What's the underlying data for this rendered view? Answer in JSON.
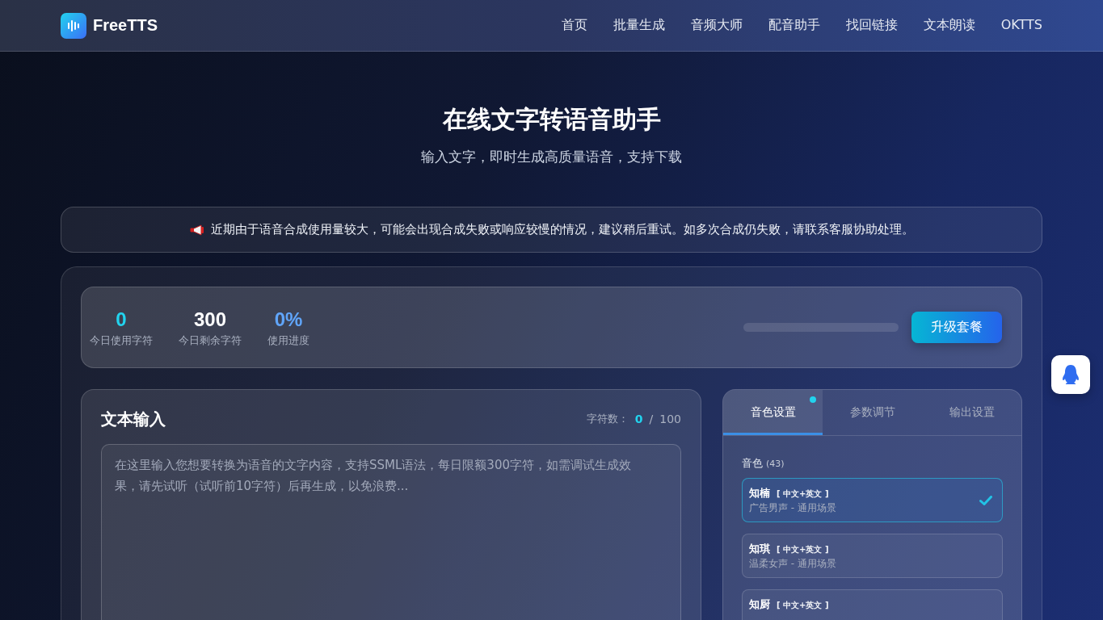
{
  "header": {
    "logo_text": "FreeTTS",
    "nav": [
      {
        "label": "首页"
      },
      {
        "label": "批量生成"
      },
      {
        "label": "音频大师"
      },
      {
        "label": "配音助手"
      },
      {
        "label": "找回链接"
      },
      {
        "label": "文本朗读"
      },
      {
        "label": "OKTTS"
      }
    ]
  },
  "hero": {
    "title": "在线文字转语音助手",
    "subtitle": "输入文字，即时生成高质量语音，支持下载"
  },
  "notice": {
    "text": "近期由于语音合成使用量较大，可能会出现合成失败或响应较慢的情况，建议稍后重试。如多次合成仍失败，请联系客服协助处理。"
  },
  "usage": {
    "stats": [
      {
        "value": "0",
        "label": "今日使用字符",
        "color": "#22d3ee"
      },
      {
        "value": "300",
        "label": "今日剩余字符",
        "color": "#ffffff"
      },
      {
        "value": "0%",
        "label": "使用进度",
        "color": "#60a5fa"
      }
    ],
    "progress": {
      "level": 0
    },
    "upgrade_button": "升级套餐"
  },
  "text_input": {
    "title": "文本输入",
    "count_label": "字符数：",
    "count": "0",
    "separator": "/",
    "limit": "100",
    "placeholder": "在这里输入您想要转换为语音的文字内容，支持SSML语法，每日限额300字符，如需调试生成效果，请先试听（试听前10字符）后再生成，以免浪费..."
  },
  "settings": {
    "tabs": [
      {
        "label": "音色设置",
        "selected": true,
        "dot": true
      },
      {
        "label": "参数调节",
        "selected": false,
        "dot": false
      },
      {
        "label": "输出设置",
        "selected": false,
        "dot": false
      }
    ],
    "voice_label": "音色",
    "voice_count": "(43)",
    "voices": [
      {
        "name": "知楠",
        "tag": "[ 中文+英文 ]",
        "description": "广告男声 - 通用场景",
        "selected": true
      },
      {
        "name": "知琪",
        "tag": "[ 中文+英文 ]",
        "description": "温柔女声 - 通用场景",
        "selected": false
      },
      {
        "name": "知厨",
        "tag": "[ 中文+英文 ]",
        "selected": false
      }
    ]
  }
}
